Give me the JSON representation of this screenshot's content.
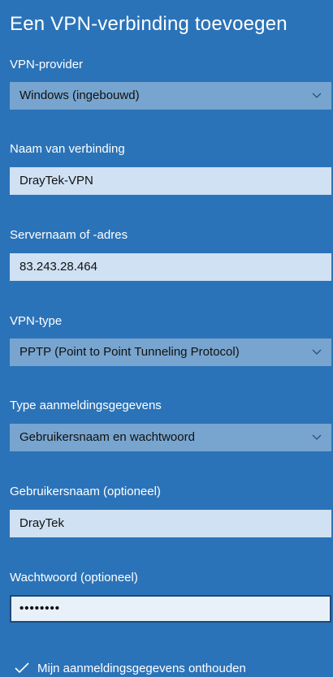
{
  "title": "Een VPN-verbinding toevoegen",
  "provider": {
    "label": "VPN-provider",
    "value": "Windows (ingebouwd)"
  },
  "connection_name": {
    "label": "Naam van verbinding",
    "value": "DrayTek-VPN"
  },
  "server": {
    "label": "Servernaam of -adres",
    "value": "83.243.28.464"
  },
  "vpn_type": {
    "label": "VPN-type",
    "value": "PPTP (Point to Point Tunneling Protocol)"
  },
  "signin_type": {
    "label": "Type aanmeldingsgegevens",
    "value": "Gebruikersnaam en wachtwoord"
  },
  "username": {
    "label": "Gebruikersnaam (optioneel)",
    "value": "DrayTek"
  },
  "password": {
    "label": "Wachtwoord (optioneel)",
    "value": "••••••••"
  },
  "remember": {
    "label": "Mijn aanmeldingsgegevens onthouden",
    "checked": true
  },
  "colors": {
    "background": "#2b73b8",
    "select_bg": "#78a5cf",
    "input_bg": "#cfe1f3",
    "focus_border": "#1e4a77"
  },
  "icons": {
    "dropdown": "chevron-down-icon",
    "checkbox": "checkmark-icon"
  }
}
